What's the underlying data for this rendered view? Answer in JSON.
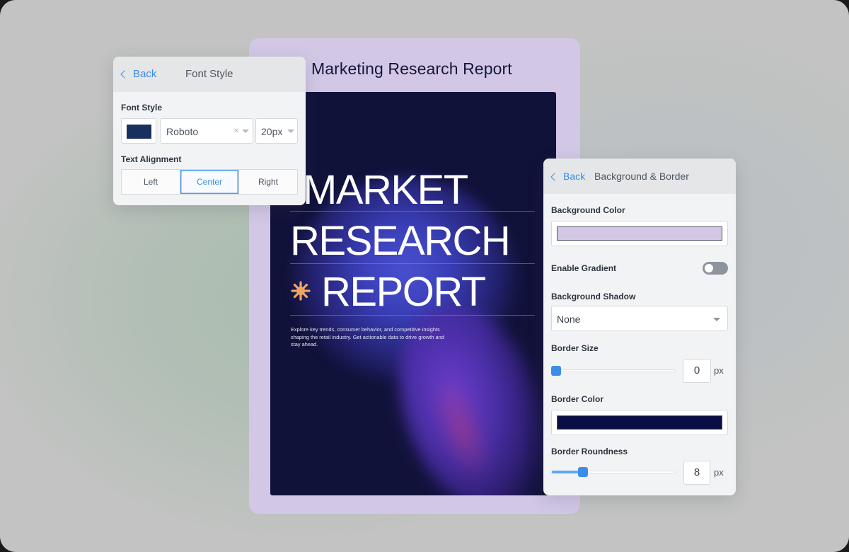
{
  "document": {
    "title": "Marketing Research Report",
    "poster": {
      "headline_line1": "MARKET",
      "headline_line2": "RESEARCH",
      "headline_line3": "REPORT",
      "description": "Explore key trends, consumer behavior, and competitive insights shaping the retail industry. Get actionable data to drive growth and stay ahead."
    }
  },
  "font_panel": {
    "back_label": "Back",
    "title": "Font Style",
    "font_style_label": "Font Style",
    "text_color": "#17305e",
    "font_family": "Roboto",
    "clear_glyph": "×",
    "font_size": "20px",
    "text_alignment_label": "Text Alignment",
    "alignment_options": [
      "Left",
      "Center",
      "Right"
    ],
    "selected_alignment": "Center"
  },
  "background_panel": {
    "back_label": "Back",
    "title": "Background & Border",
    "background_color_label": "Background Color",
    "background_color": "#d2c8e6",
    "enable_gradient_label": "Enable Gradient",
    "gradient_enabled": false,
    "background_shadow_label": "Background Shadow",
    "background_shadow_value": "None",
    "border_size_label": "Border Size",
    "border_size_value": "0",
    "border_size_unit": "px",
    "border_color_label": "Border Color",
    "border_color": "#0a0e45",
    "border_roundness_label": "Border Roundness",
    "border_roundness_value": "8",
    "border_roundness_unit": "px"
  },
  "colors": {
    "accent": "#3a8ee8",
    "poster_background": "#11123a",
    "sparkle": "#f3a55e"
  }
}
